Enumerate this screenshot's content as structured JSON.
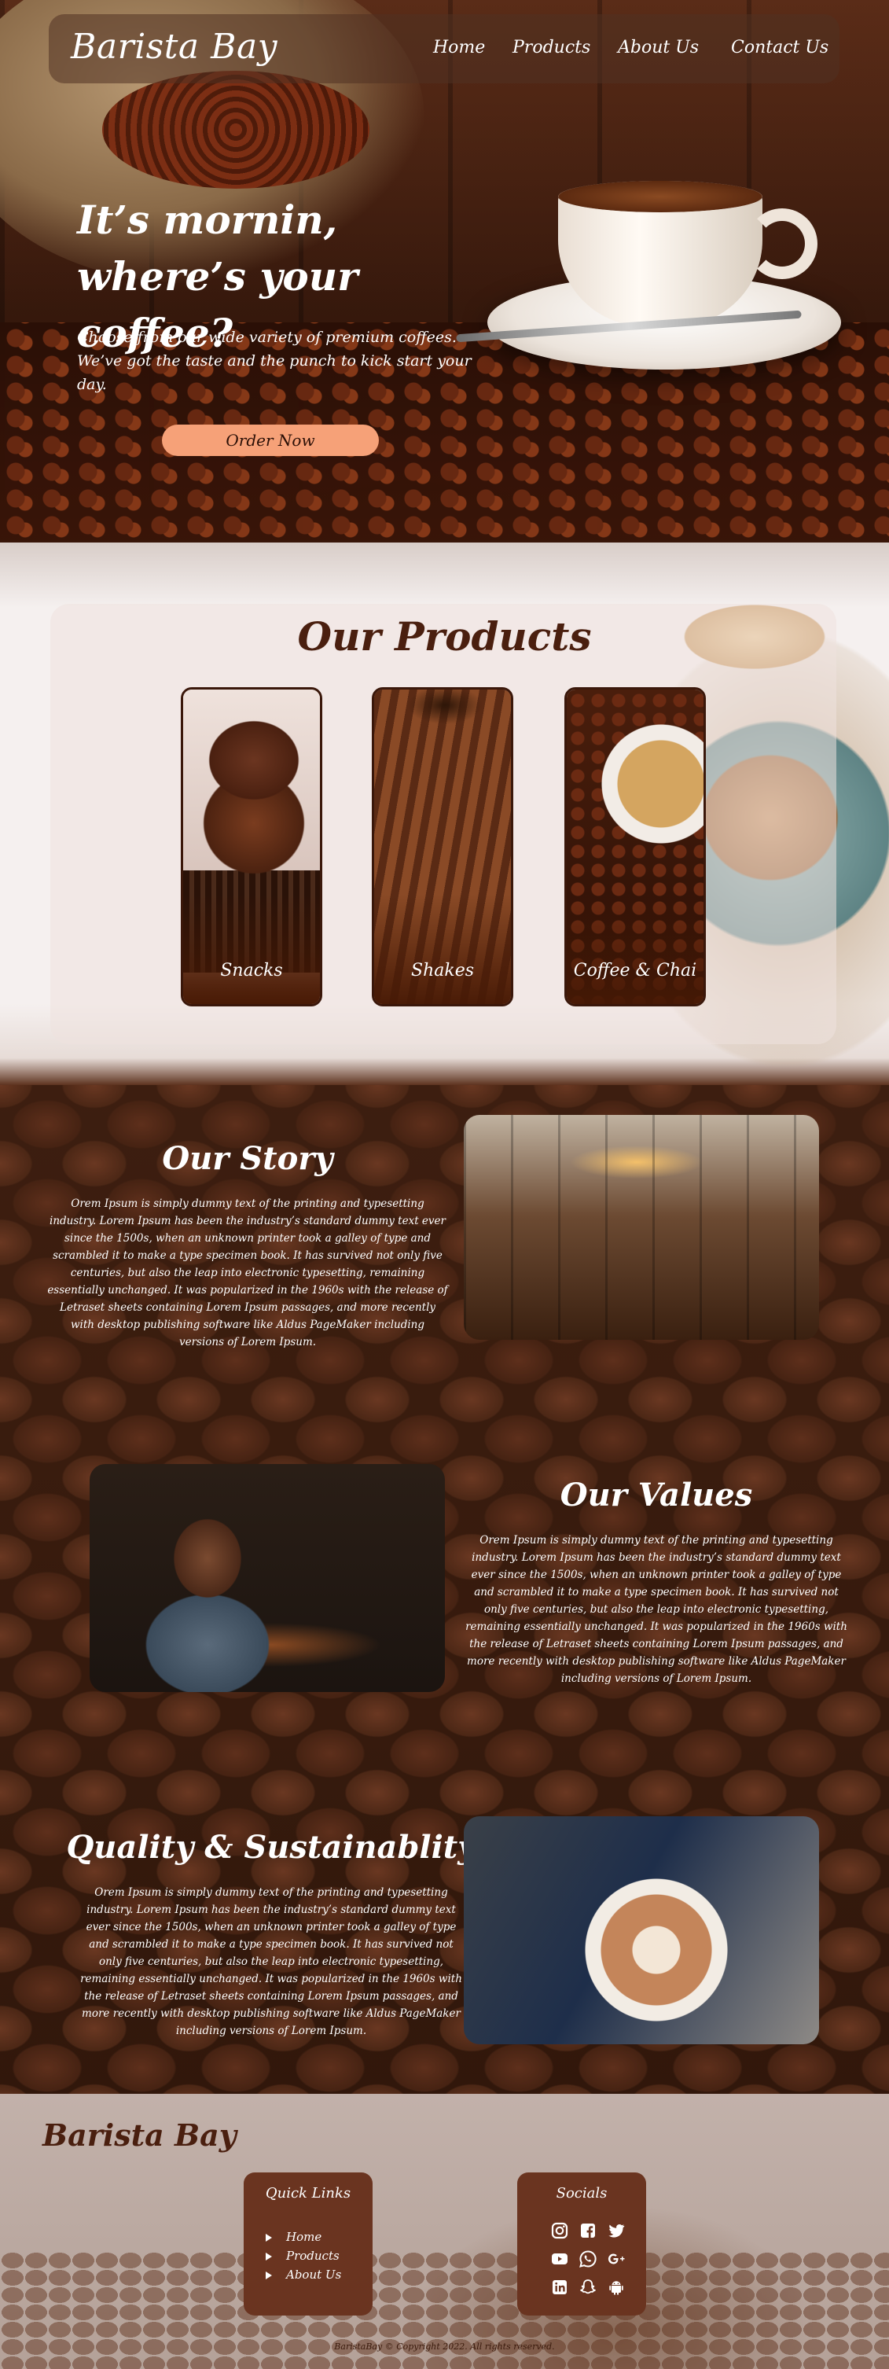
{
  "brand": "Barista Bay",
  "nav": {
    "items": [
      "Home",
      "Products",
      "About Us",
      "Contact Us"
    ]
  },
  "hero": {
    "title": "It’s mornin, where’s your coffee?",
    "text": "Choose from our wide variety of premium coffees. We’ve got the taste and the punch to kick start your day.",
    "cta": "Order Now"
  },
  "products": {
    "title": "Our Products",
    "items": [
      "Snacks",
      "Shakes",
      "Coffee & Chai"
    ]
  },
  "story": {
    "title": "Our Story",
    "text": "Orem Ipsum is simply dummy text of the printing and typesetting industry. Lorem Ipsum has been the industry’s standard dummy text ever since the 1500s, when an unknown printer took a galley of type and scrambled it to make a type specimen book. It has survived not only five centuries, but also the leap into electronic typesetting, remaining essentially unchanged. It was popularized in the 1960s with the release of Letraset sheets containing Lorem Ipsum passages, and more recently with desktop publishing software like Aldus PageMaker including versions of Lorem Ipsum."
  },
  "values": {
    "title": "Our Values",
    "text": "Orem Ipsum is simply dummy text of the printing and typesetting industry. Lorem Ipsum has been the industry’s standard dummy text ever since the 1500s, when an unknown printer took a galley of type and scrambled it to make a type specimen book. It has survived not only five centuries, but also the leap into electronic typesetting, remaining essentially unchanged. It was popularized in the 1960s with the release of Letraset sheets containing Lorem Ipsum passages, and more recently with desktop publishing software like Aldus PageMaker including versions of Lorem Ipsum."
  },
  "quality": {
    "title": "Quality & Sustainablity",
    "text": "Orem Ipsum is simply dummy text of the printing and typesetting industry. Lorem Ipsum has been the industry’s standard dummy text ever since the 1500s, when an unknown printer took a galley of type and scrambled it to make a type specimen book. It has survived not only five centuries, but also the leap into electronic typesetting, remaining essentially unchanged. It was popularized in the 1960s with the release of Letraset sheets containing Lorem Ipsum passages, and more recently with desktop publishing software like Aldus PageMaker including versions of Lorem Ipsum."
  },
  "footer": {
    "brand": "Barista Bay",
    "quick_links_title": "Quick Links",
    "quick_links": [
      "Home",
      "Products",
      "About Us"
    ],
    "socials_title": "Socials",
    "socials": [
      "instagram-icon",
      "facebook-icon",
      "twitter-icon",
      "youtube-icon",
      "whatsapp-icon",
      "google-plus-icon",
      "linkedin-icon",
      "snapchat-icon",
      "android-icon"
    ],
    "copyright": "BaristaBay © Copyright 2022. All rights reserved."
  },
  "colors": {
    "accent": "#f6a178",
    "brand_brown": "#4a1f0f",
    "footer_box": "#6a3420"
  }
}
